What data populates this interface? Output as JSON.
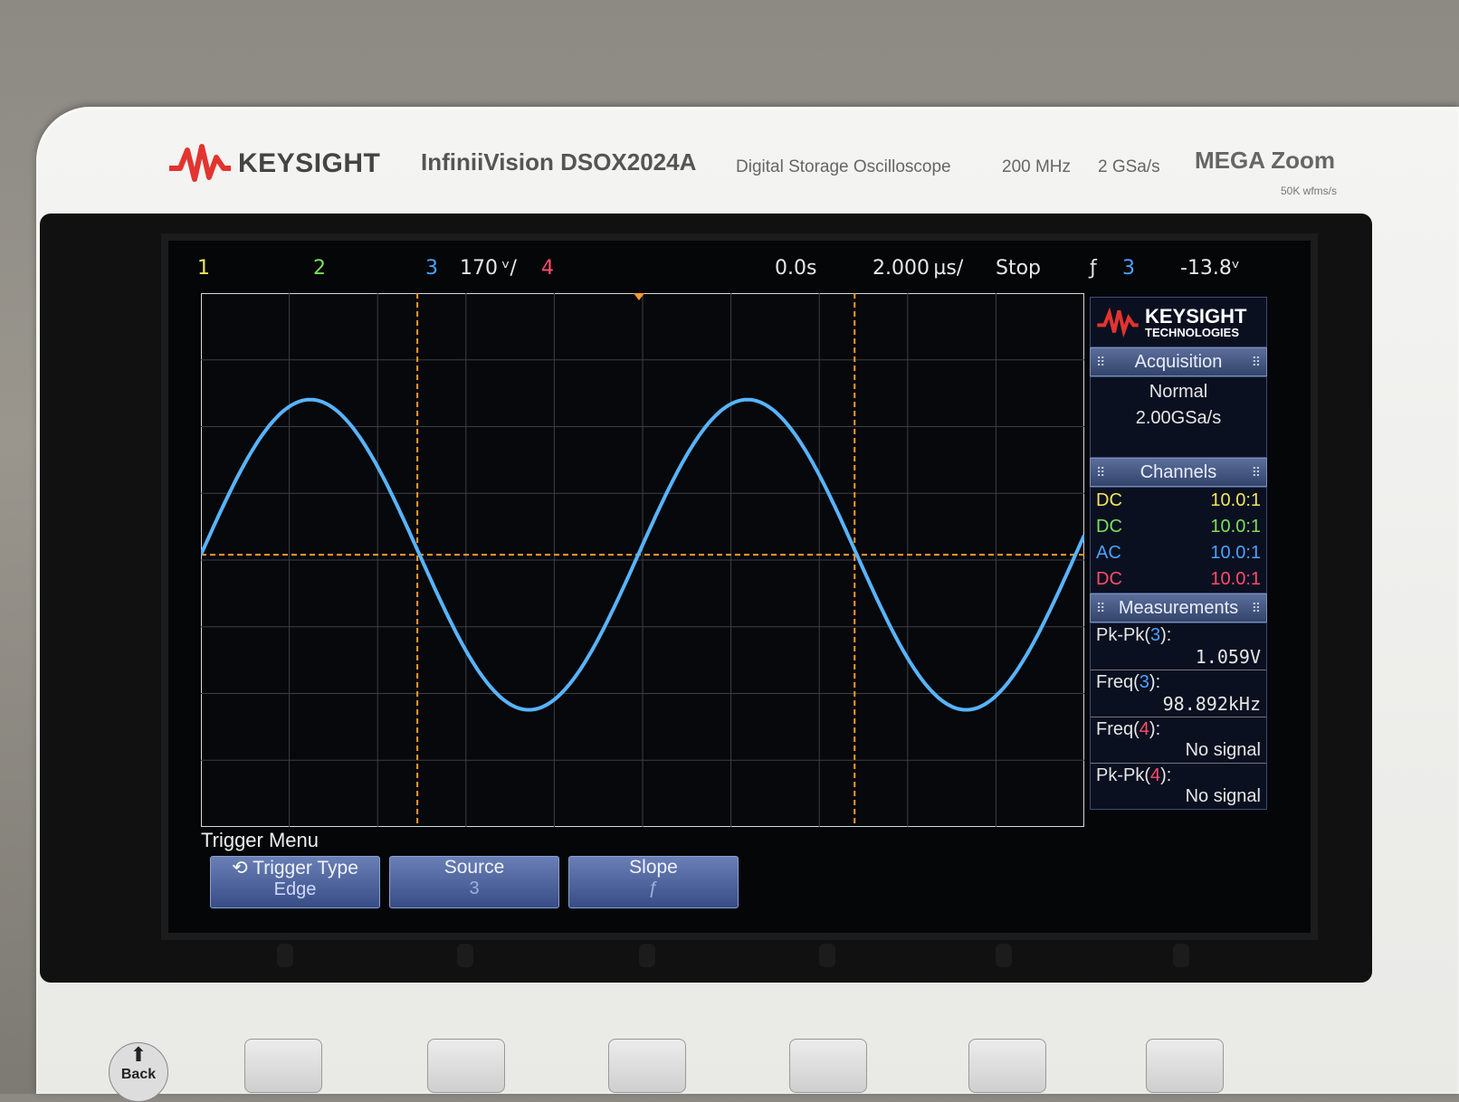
{
  "brand": {
    "name": "KEYSIGHT",
    "model": "InfiniiVision DSOX2024A",
    "description": "Digital Storage Oscilloscope",
    "bandwidth": "200 MHz",
    "sample_rate": "2 GSa/s",
    "megazoom": "MEGA Zoom",
    "megazoom_sub": "50K wfms/s"
  },
  "status": {
    "ch1": "1",
    "ch2": "2",
    "ch3": "3",
    "ch3_scale": "170 ᵛ/",
    "ch4": "4",
    "time_offset": "0.0s",
    "time_scale": "2.000 µs/",
    "run_state": "Stop",
    "trigger_slope": "ƒ",
    "trigger_source": "3",
    "trigger_level": "-13.8ᵛ"
  },
  "colors": {
    "ch1": "#f2e65a",
    "ch2": "#7ddf5a",
    "ch3": "#4aa3ff",
    "ch4": "#ff4d6d",
    "trace": "#58b4ff",
    "cursor": "#ff9a2e",
    "grid": "#3a3f48"
  },
  "side_logo": {
    "line1": "KEYSIGHT",
    "line2": "TECHNOLOGIES"
  },
  "acquisition": {
    "title": "Acquisition",
    "mode": "Normal",
    "rate": "2.00GSa/s"
  },
  "channels": {
    "title": "Channels",
    "rows": [
      {
        "coupling": "DC",
        "probe": "10.0:1"
      },
      {
        "coupling": "DC",
        "probe": "10.0:1"
      },
      {
        "coupling": "AC",
        "probe": "10.0:1"
      },
      {
        "coupling": "DC",
        "probe": "10.0:1"
      }
    ]
  },
  "measurements": {
    "title": "Measurements",
    "items": [
      {
        "label": "Pk-Pk(",
        "ch": "3",
        "end": "):",
        "value": "1.059V"
      },
      {
        "label": "Freq(",
        "ch": "3",
        "end": "):",
        "value": "98.892kHz"
      },
      {
        "label": "Freq(",
        "ch": "4",
        "end": "):",
        "value": "No signal"
      },
      {
        "label": "Pk-Pk(",
        "ch": "4",
        "end": "):",
        "value": "No signal"
      }
    ]
  },
  "ch3_marker": "3",
  "trigger_menu": {
    "title": "Trigger Menu",
    "keys": [
      {
        "label": "Trigger Type",
        "value": "Edge"
      },
      {
        "label": "Source",
        "value": "3"
      },
      {
        "label": "Slope",
        "value": "ƒ"
      }
    ]
  },
  "back_label": "Back",
  "waveform": {
    "type": "sine",
    "cycles_shown": 2.0,
    "amplitude_divisions": 2.5
  }
}
